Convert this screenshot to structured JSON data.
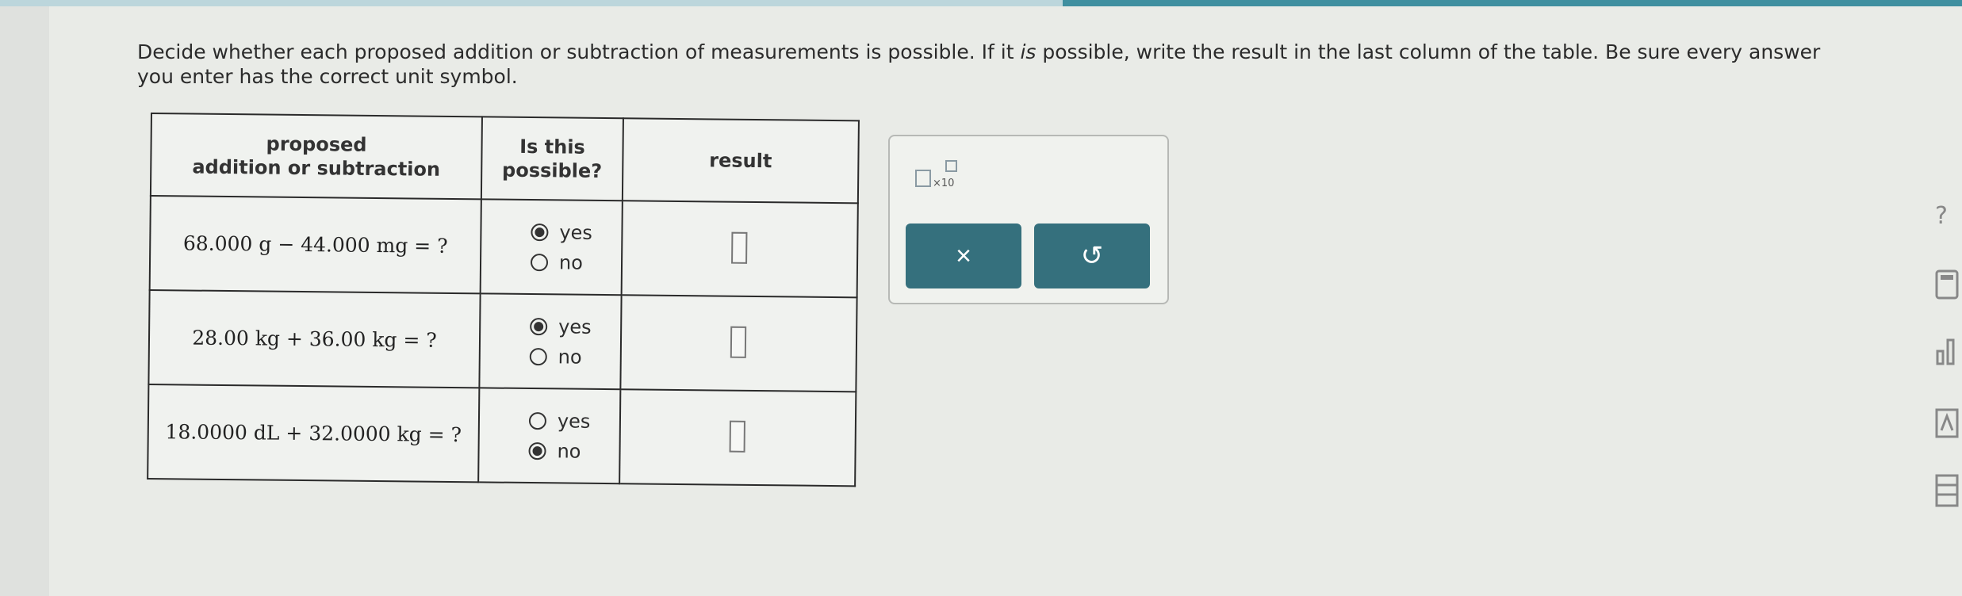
{
  "instructions": {
    "part1": "Decide whether each proposed addition or subtraction of measurements is possible. If it ",
    "is": "is",
    "part2": " possible, write the result in the last column of the table. Be sure every answer you enter has the correct unit symbol."
  },
  "table": {
    "headers": {
      "col1_line1": "proposed",
      "col1_line2": "addition or subtraction",
      "col2_line1": "Is this",
      "col2_line2": "possible?",
      "col3": "result"
    },
    "rows": [
      {
        "expression": "68.000 g − 44.000 mg = ?",
        "options": [
          "yes",
          "no"
        ],
        "selected": "yes",
        "result": ""
      },
      {
        "expression": "28.00 kg + 36.00 kg = ?",
        "options": [
          "yes",
          "no"
        ],
        "selected": "yes",
        "result": ""
      },
      {
        "expression": "18.0000 dL + 32.0000 kg = ?",
        "options": [
          "yes",
          "no"
        ],
        "selected": "no",
        "result": ""
      }
    ]
  },
  "tools": {
    "sci_notation_times": "×10",
    "clear_icon": "×",
    "reset_icon": "↺"
  },
  "sidebar": {
    "help_icon": "?",
    "calculator_icon": "calculator-icon",
    "chart_icon": "chart-icon",
    "reference_icon": "reference-icon",
    "periodic_table_icon": "periodic-table-icon"
  },
  "colors": {
    "button": "#35707d",
    "accent_bar": "#3f8fa0"
  }
}
